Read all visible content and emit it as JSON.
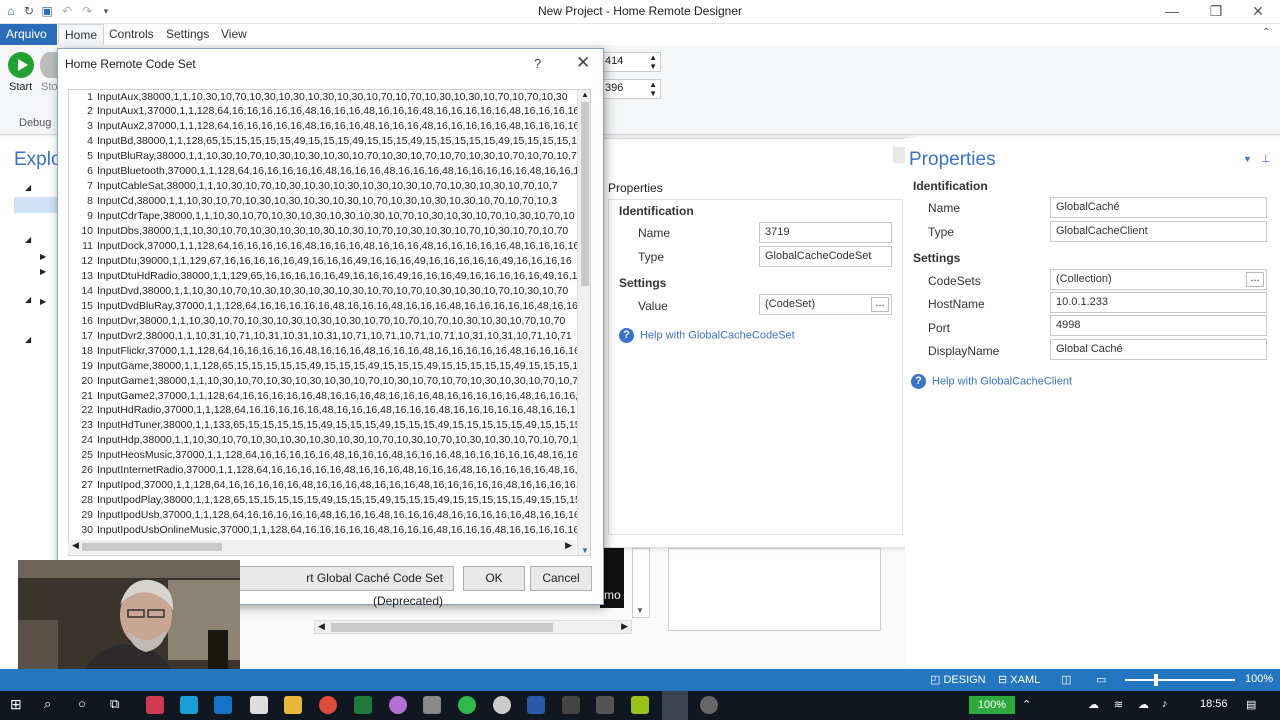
{
  "window": {
    "title": "New Project - Home Remote Designer"
  },
  "ribbon_tabs": [
    "Arquivo",
    "Home",
    "Controls",
    "Settings",
    "View"
  ],
  "ribbon": {
    "start_label": "Start",
    "stop_label": "Sto",
    "debug_label": "Debug",
    "field1_value": "414",
    "field2_value": "396"
  },
  "explorer": {
    "title": "Explo"
  },
  "dialog": {
    "title": "Home Remote Code Set",
    "help": "?",
    "close": "✕",
    "lines": [
      {
        "n": "1",
        "text": "InputAux,38000,1,1,10,30,10,70,10,30,10,30,10,30,10,30,10,70,10,70,10,30,10,30,10,70,10,70,10,30"
      },
      {
        "n": "2",
        "text": "InputAux1,37000,1,1,128,64,16,16,16,16,16,48,16,16,16,48,16,16,16,48,16,16,16,16,16,48,16,16,16,16,16"
      },
      {
        "n": "3",
        "text": "InputAux2,37000,1,1,128,64,16,16,16,16,16,48,16,16,16,48,16,16,16,48,16,16,16,16,16,48,16,16,16,16,16"
      },
      {
        "n": "4",
        "text": "InputBd,38000,1,1,128,65,15,15,15,15,15,49,15,15,15,49,15,15,15,49,15,15,15,15,15,49,15,15,15,15,15"
      },
      {
        "n": "5",
        "text": "InputBluRay,38000,1,1,10,30,10,70,10,30,10,30,10,30,10,70,10,30,10,70,10,70,10,30,10,70,10,70,10,70"
      },
      {
        "n": "6",
        "text": "InputBluetooth,37000,1,1,128,64,16,16,16,16,16,48,16,16,16,48,16,16,16,48,16,16,16,16,16,48,16,16,1"
      },
      {
        "n": "7",
        "text": "InputCableSat,38000,1,1,10,30,10,70,10,30,10,30,10,30,10,30,10,30,10,70,10,30,10,30,10,70,10,7"
      },
      {
        "n": "8",
        "text": "InputCd,38000,1,1,10,30,10,70,10,30,10,30,10,30,10,30,10,70,10,30,10,30,10,30,10,70,10,70,10,3"
      },
      {
        "n": "9",
        "text": "InputCdrTape,38000,1,1,10,30,10,70,10,30,10,30,10,30,10,30,10,70,10,30,10,30,10,70,10,30,10,70,10"
      },
      {
        "n": "10",
        "text": "InputDbs,38000,1,1,10,30,10,70,10,30,10,30,10,30,10,30,10,70,10,30,10,30,10,70,10,30,10,70,10,70"
      },
      {
        "n": "11",
        "text": "InputDock,37000,1,1,128,64,16,16,16,16,16,48,16,16,16,48,16,16,16,48,16,16,16,16,16,48,16,16,16,16"
      },
      {
        "n": "12",
        "text": "InputDtu,39000,1,1,129,67,16,16,16,16,16,49,16,16,16,49,16,16,16,49,16,16,16,16,16,49,16,16,16,16"
      },
      {
        "n": "13",
        "text": "InputDtuHdRadio,38000,1,1,129,65,16,16,16,16,16,49,16,16,16,49,16,16,16,49,16,16,16,16,16,49,16,1"
      },
      {
        "n": "14",
        "text": "InputDvd,38000,1,1,10,30,10,70,10,30,10,30,10,30,10,30,10,70,10,70,10,30,10,30,10,70,10,30,10,70"
      },
      {
        "n": "15",
        "text": "InputDvdBluRay,37000,1,1,128,64,16,16,16,16,16,48,16,16,16,48,16,16,16,48,16,16,16,16,16,48,16,16"
      },
      {
        "n": "16",
        "text": "InputDvr,38000,1,1,10,30,10,70,10,30,10,30,10,30,10,30,10,70,10,70,10,70,10,30,10,30,10,70,10,70"
      },
      {
        "n": "17",
        "text": "InputDvr2,38000,1,1,10,31,10,71,10,31,10,31,10,31,10,71,10,71,10,71,10,71,10,31,10,31,10,71,10,71"
      },
      {
        "n": "18",
        "text": "InputFlickr,37000,1,1,128,64,16,16,16,16,16,48,16,16,16,48,16,16,16,48,16,16,16,16,16,48,16,16,16,16"
      },
      {
        "n": "19",
        "text": "InputGame,38000,1,1,128,65,15,15,15,15,15,49,15,15,15,49,15,15,15,49,15,15,15,15,15,49,15,15,15,15"
      },
      {
        "n": "20",
        "text": "InputGame1,38000,1,1,10,30,10,70,10,30,10,30,10,30,10,70,10,30,10,70,10,70,10,30,10,30,10,70,10,70"
      },
      {
        "n": "21",
        "text": "InputGame2,37000,1,1,128,64,16,16,16,16,16,48,16,16,16,48,16,16,16,48,16,16,16,16,16,48,16,16,16,1"
      },
      {
        "n": "22",
        "text": "InputHdRadio,37000,1,1,128,64,16,16,16,16,16,48,16,16,16,48,16,16,16,48,16,16,16,16,16,48,16,16,1"
      },
      {
        "n": "23",
        "text": "InputHdTuner,38000,1,1,133,65,15,15,15,15,15,49,15,15,15,49,15,15,15,49,15,15,15,15,15,49,15,15,15"
      },
      {
        "n": "24",
        "text": "InputHdp,38000,1,1,10,30,10,70,10,30,10,30,10,30,10,30,10,70,10,30,10,70,10,30,10,30,10,70,10,70,10"
      },
      {
        "n": "25",
        "text": "InputHeosMusic,37000,1,1,128,64,16,16,16,16,16,48,16,16,16,48,16,16,16,48,16,16,16,16,16,48,16,16,"
      },
      {
        "n": "26",
        "text": "InputInternetRadio,37000,1,1,128,64,16,16,16,16,16,48,16,16,16,48,16,16,16,48,16,16,16,16,16,48,16,"
      },
      {
        "n": "27",
        "text": "InputIpod,37000,1,1,128,64,16,16,16,16,16,48,16,16,16,48,16,16,16,48,16,16,16,16,16,48,16,16,16,16,"
      },
      {
        "n": "28",
        "text": "InputIpodPlay,38000,1,1,128,65,15,15,15,15,15,49,15,15,15,49,15,15,15,49,15,15,15,15,15,49,15,15,15"
      },
      {
        "n": "29",
        "text": "InputIpodUsb,37000,1,1,128,64,16,16,16,16,16,48,16,16,16,48,16,16,16,48,16,16,16,16,16,48,16,16,16,16"
      },
      {
        "n": "30",
        "text": "InputIpodUsbOnlineMusic,37000,1,1,128,64,16,16,16,16,16,48,16,16,16,48,16,16,16,48,16,16,16,16,16,16"
      }
    ],
    "import_label": "rt Global Caché Code Set (Deprecated)",
    "ok_label": "OK",
    "cancel_label": "Cancel"
  },
  "codeset_panel": {
    "header": "Properties",
    "identification": "Identification",
    "name_label": "Name",
    "name_value": "3719",
    "type_label": "Type",
    "type_value": "GlobalCacheCodeSet",
    "settings": "Settings",
    "value_label": "Value",
    "value_value": "(CodeSet)",
    "ellipsis": "...",
    "help": "Help with GlobalCacheCodeSet"
  },
  "properties": {
    "title": "Properties",
    "identification": "Identification",
    "name_label": "Name",
    "name_value": "GlobalCaché",
    "type_label": "Type",
    "type_value": "GlobalCacheClient",
    "settings": "Settings",
    "codesets_label": "CodeSets",
    "codesets_value": "(Collection)",
    "ellipsis": "...",
    "hostname_label": "HostName",
    "hostname_value": "10.0.1.233",
    "port_label": "Port",
    "port_value": "4998",
    "displayname_label": "DisplayName",
    "displayname_value": "Global Caché",
    "help": "Help with GlobalCacheClient"
  },
  "canvas_text": "mo",
  "statusbar": {
    "design": "DESIGN",
    "xaml": "XAML",
    "zoom": "100%"
  },
  "taskbar": {
    "battery": "100%",
    "time": "18:56"
  },
  "colors": {
    "accent": "#2576c1",
    "file_tab": "#2b6cb8",
    "link": "#3a73c9",
    "taskbar": "#101720"
  }
}
